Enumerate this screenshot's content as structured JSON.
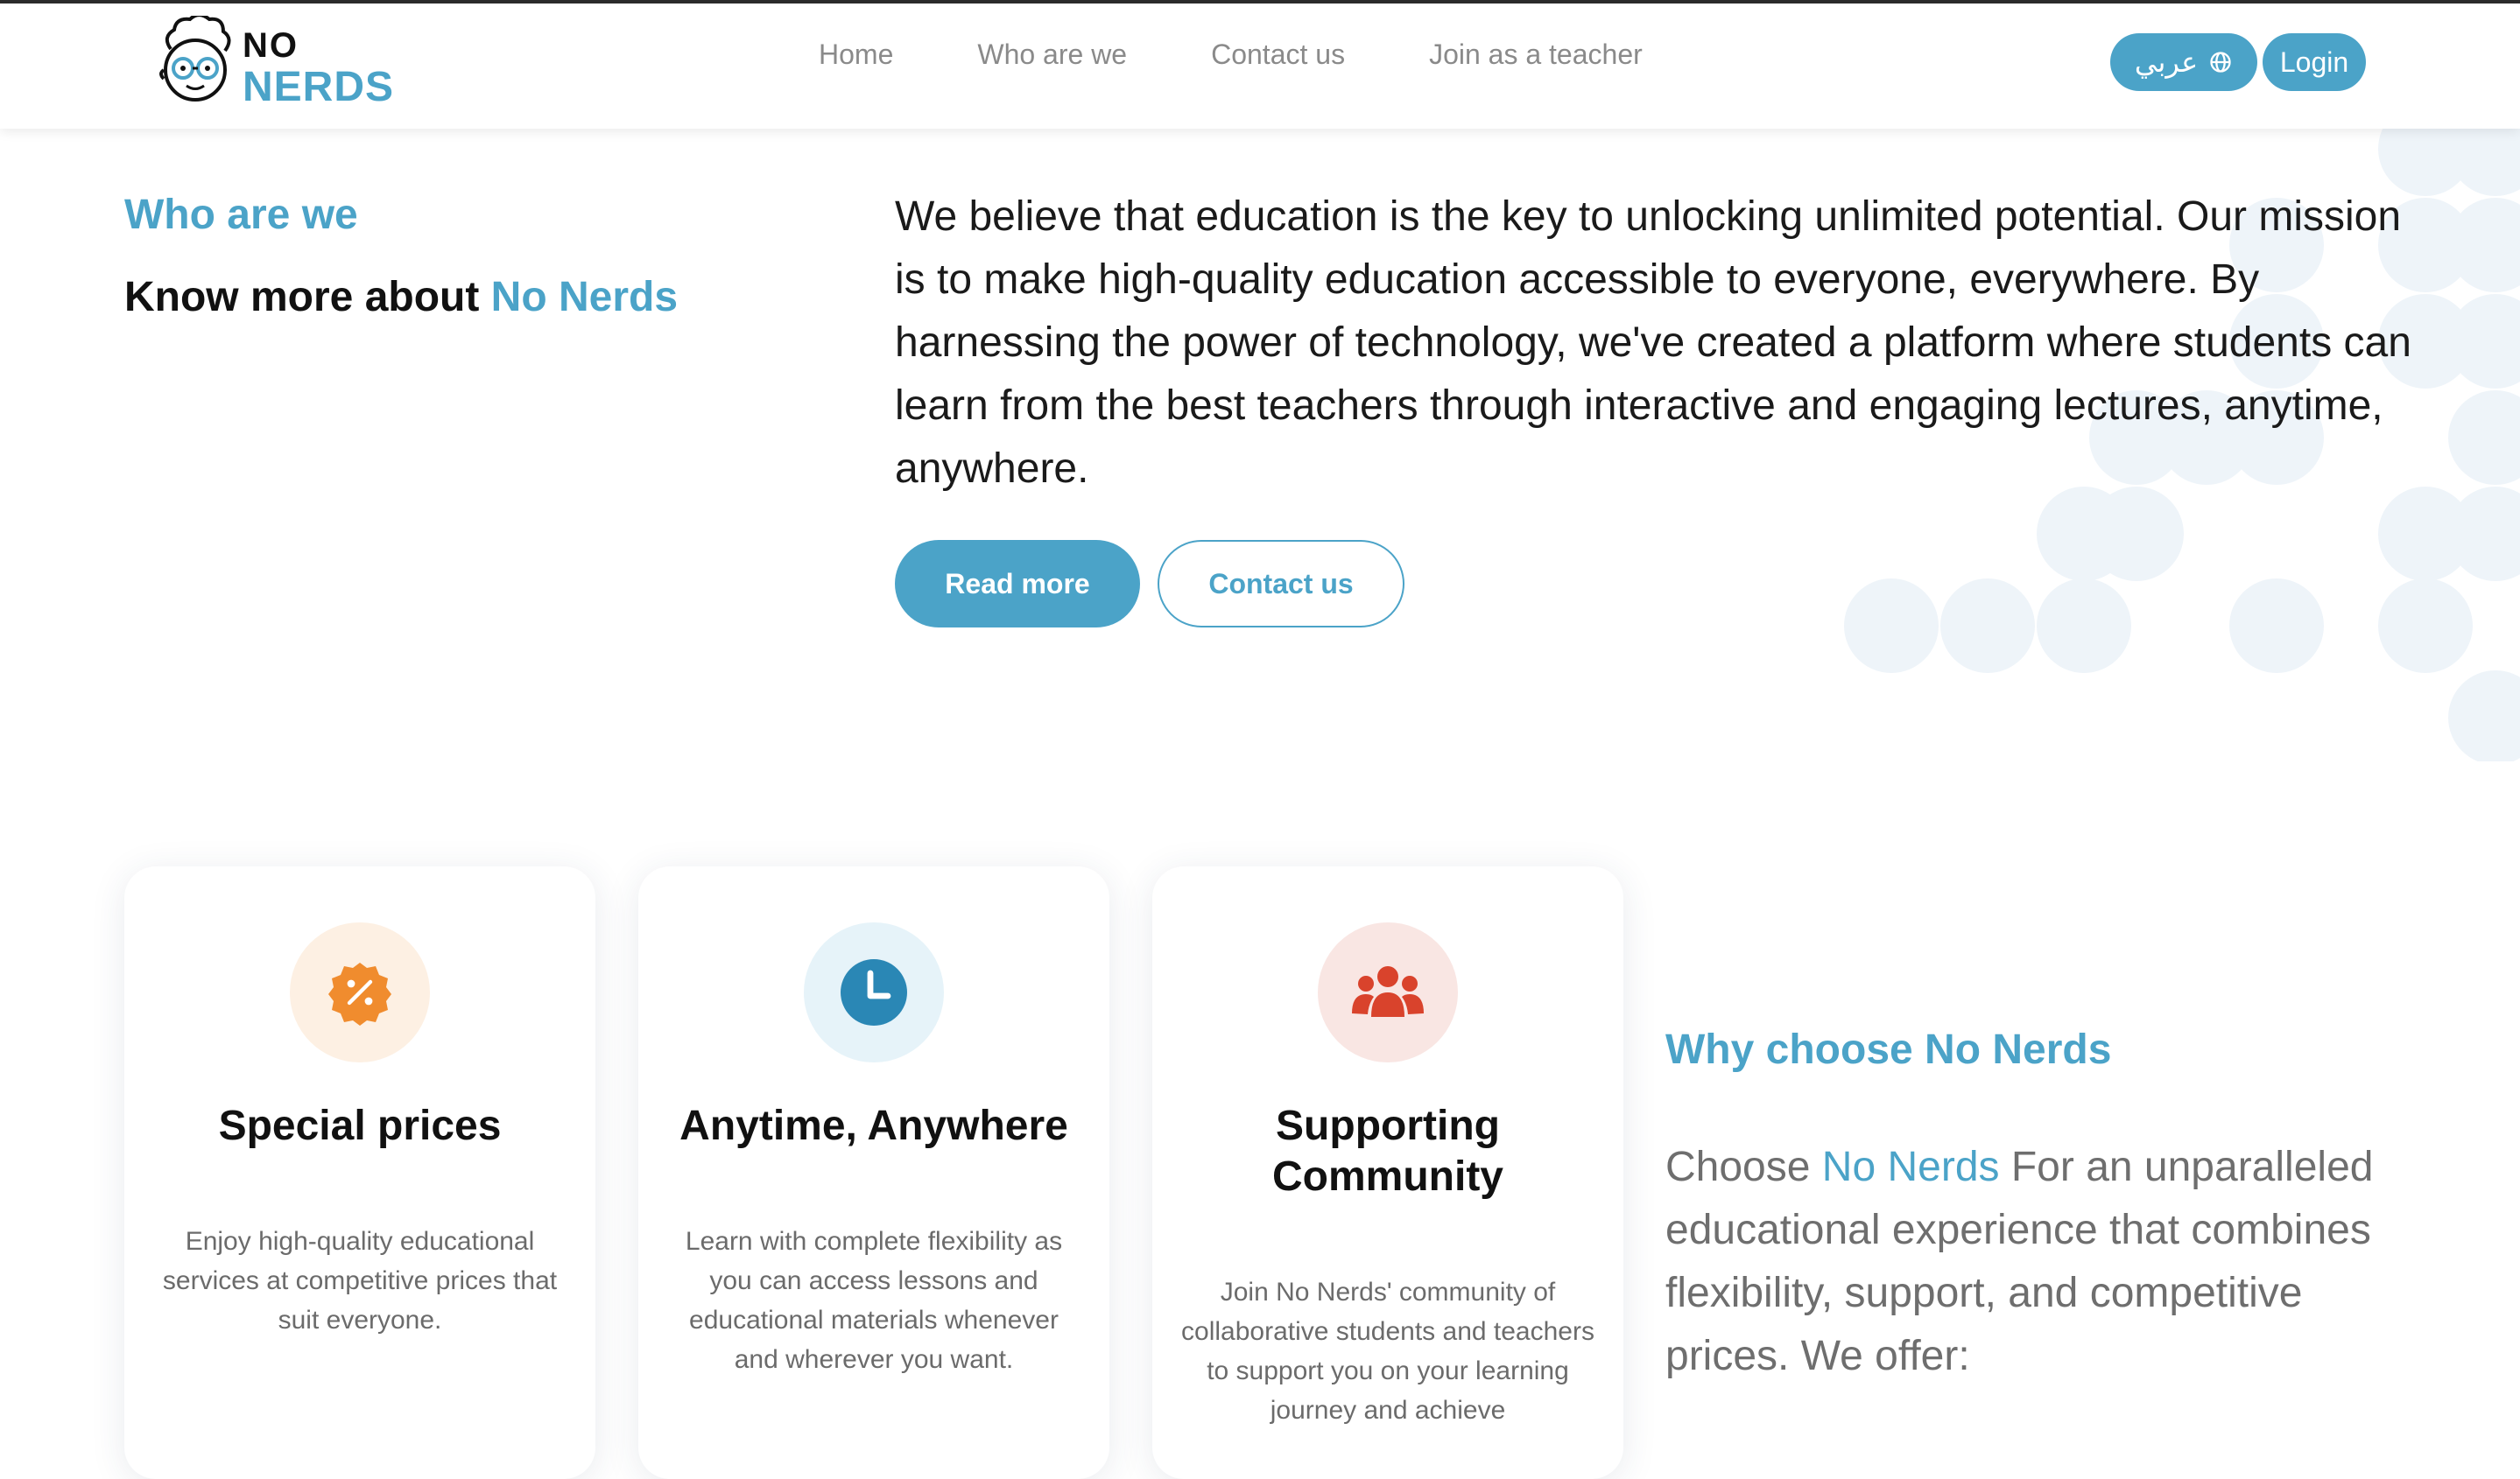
{
  "brand": {
    "logo_top": "NO",
    "logo_bottom": "NERDS"
  },
  "nav": {
    "items": [
      {
        "label": "Home"
      },
      {
        "label": "Who are we"
      },
      {
        "label": "Contact us"
      },
      {
        "label": "Join as a teacher"
      }
    ],
    "language_label": "عربي",
    "login_label": "Login"
  },
  "about": {
    "label": "Who are we",
    "title_prefix": "Know more about ",
    "title_accent": "No Nerds",
    "text": "We believe that education is the key to unlocking unlimited potential. Our mission is to make high-quality education accessible to everyone, everywhere. By harnessing the power of technology, we've created a platform where students can learn from the best teachers through interactive and engaging lectures, anytime, anywhere.",
    "read_more_label": "Read more",
    "contact_label": "Contact us"
  },
  "features": [
    {
      "icon": "percent-badge-icon",
      "title": "Special prices",
      "text": "Enjoy high-quality educational services at competitive prices that suit everyone."
    },
    {
      "icon": "clock-icon",
      "title": "Anytime, Anywhere",
      "text": "Learn with complete flexibility as you can access lessons and educational materials whenever and wherever you want."
    },
    {
      "icon": "community-icon",
      "title": "Supporting Community",
      "text": "Join No Nerds' community of collaborative students and teachers to support you on your learning journey and achieve"
    }
  ],
  "why": {
    "label": "Why choose No Nerds",
    "text_prefix": "Choose ",
    "text_accent": "No Nerds",
    "text_rest": " For an unparalleled educational experience that combines flexibility, support, and competitive prices. We offer:"
  },
  "colors": {
    "accent": "#4ba3c8",
    "orange": "#f08c2e",
    "red": "#d9432c"
  }
}
